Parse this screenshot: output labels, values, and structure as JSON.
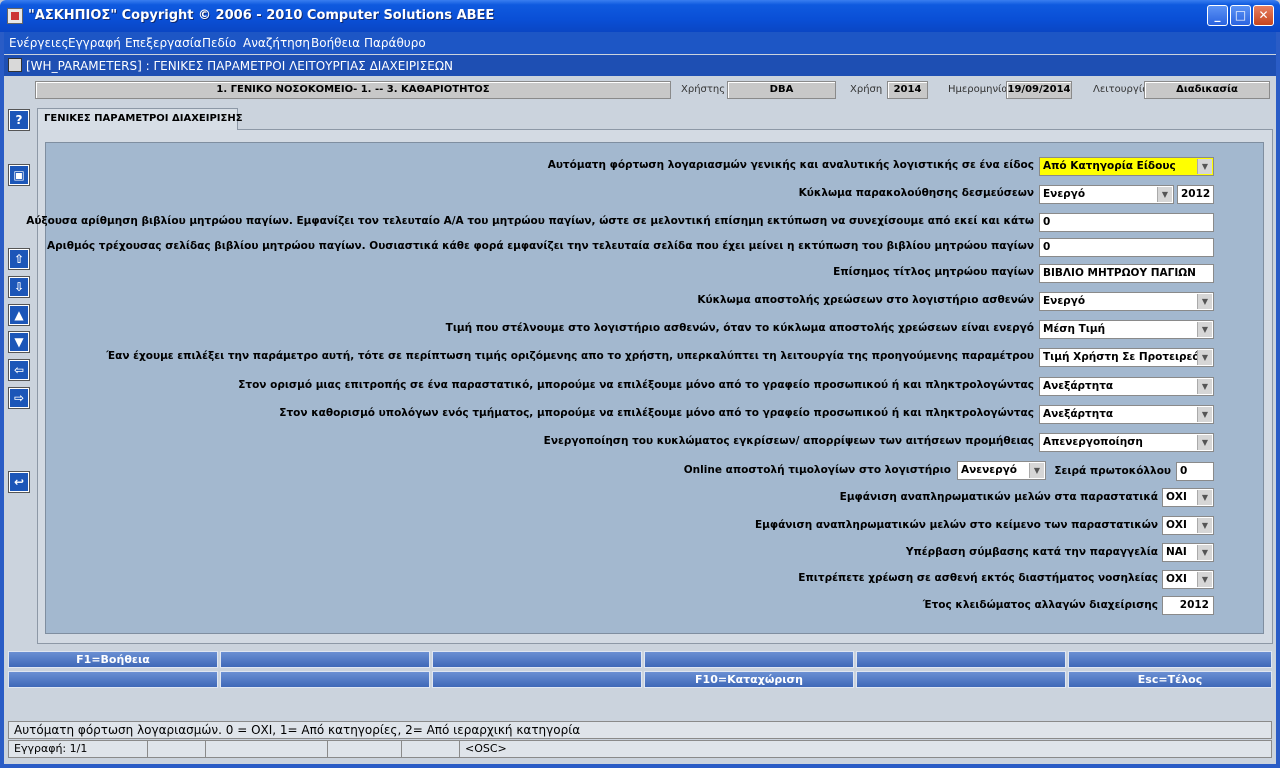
{
  "window": {
    "title": "\"ΑΣΚΗΠΙΟΣ\" Copyright © 2006 - 2010 Computer Solutions ΑΒΕΕ",
    "minimize": "_",
    "maximize": "□",
    "close": "✕"
  },
  "menu": [
    "Ενέργειες",
    "Εγγραφή",
    "Επεξεργασία",
    "Πεδίο",
    "Αναζήτηση",
    "Βοήθεια",
    "Παράθυρο"
  ],
  "form": {
    "title": "[WH_PARAMETERS]   :  ΓΕΝΙΚΕΣ ΠΑΡΑΜΕΤΡΟΙ ΛΕΙΤΟΥΡΓΙΑΣ ΔΙΑΧΕΙΡΙΣΕΩΝ"
  },
  "info": {
    "org": "1. ΓΕΝΙΚΟ ΝΟΣΟΚΟΜΕΙΟ- 1. -- 3. ΚΑΘΑΡΙΟΤΗΤΟΣ",
    "user_label": "Χρήστης",
    "user": "DBA",
    "year_label": "Χρήση",
    "year": "2014",
    "date_label": "Ημερομηνία",
    "date": "19/09/2014",
    "mode_label": "Λειτουργία",
    "mode": "Διαδικασία"
  },
  "side_icons": [
    "help-icon",
    "save-icon",
    "first-record-icon",
    "last-record-icon",
    "previous-record-icon",
    "next-record-icon",
    "previous-block-icon",
    "next-block-icon",
    "exit-icon"
  ],
  "side_glyphs": {
    "help": "?",
    "save": "▣",
    "first": "⇧",
    "last": "⇩",
    "prev": "▲",
    "next": "▼",
    "prev_block": "⇦",
    "next_block": "⇨",
    "exit": "↩"
  },
  "tab": "ΓΕΝΙΚΕΣ ΠΑΡΑΜΕΤΡΟΙ ΔΙΑΧΕΙΡΙΣΗΣ",
  "params": {
    "p1_label": "Αυτόματη φόρτωση λογαριασμών γενικής και αναλυτικής λογιστικής σε ένα είδος",
    "p1_value": "Από Κατηγορία Είδους",
    "p2_label": "Κύκλωμα παρακολούθησης δεσμεύσεων",
    "p2_value": "Ενεργό",
    "p2_year": "2012",
    "p3_label": "Αύξουσα αρίθμηση βιβλίου μητρώου παγίων. Εμφανίζει τον τελευταίο Α/Α του μητρώου παγίων, ώστε σε μελοντική επίσημη εκτύπωση να συνεχίσουμε από εκεί και κάτω",
    "p3_value": "0",
    "p4_label": "Αριθμός τρέχουσας σελίδας βιβλίου μητρώου παγίων. Ουσιαστικά κάθε φορά εμφανίζει την τελευταία σελίδα που έχει μείνει η εκτύπωση του βιβλίου μητρώου παγίων",
    "p4_value": "0",
    "p5_label": "Επίσημος τίτλος μητρώου παγίων",
    "p5_value": "ΒΙΒΛΙΟ ΜΗΤΡΩΟΥ ΠΑΓΙΩΝ",
    "p6_label": "Κύκλωμα αποστολής χρεώσεων στο λογιστήριο ασθενών",
    "p6_value": "Ενεργό",
    "p7_label": "Τιμή που στέλνουμε στο λογιστήριο ασθενών, όταν το κύκλωμα αποστολής χρεώσεων είναι ενεργό",
    "p7_value": "Μέση Τιμή",
    "p8_label": "Έαν έχουμε επιλέξει την παράμετρο αυτή, τότε σε περίπτωση τιμής οριζόμενης απο το χρήστη, υπερκαλύπτει τη λειτουργία της προηγούμενης παραμέτρου",
    "p8_value": "Τιμή Χρήστη Σε Προτειρεό...",
    "p9_label": "Στον ορισμό μιας επιτροπής σε ένα παραστατικό, μπορούμε να επιλέξουμε μόνο από το γραφείο προσωπικού ή και πληκτρολογώντας",
    "p9_value": "Ανεξάρτητα",
    "p10_label": "Στον καθορισμό υπολόγων ενός τμήματος, μπορούμε να επιλέξουμε μόνο από το γραφείο προσωπικού ή και πληκτρολογώντας",
    "p10_value": "Ανεξάρτητα",
    "p11_label": "Ενεργοποίηση του κυκλώματος εγκρίσεων/ απορρίψεων των αιτήσεων προμήθειας",
    "p11_value": "Απενεργοποίηση",
    "p12_label": "Online αποστολή τιμολογίων στο λογιστήριο",
    "p12_value": "Ανενεργό",
    "p12b_label": "Σειρά πρωτοκόλλου",
    "p12b_value": "0",
    "p13_label": "Εμφάνιση αναπληρωματικών μελών στα παραστατικά",
    "p13_value": "ΟΧΙ",
    "p14_label": "Εμφάνιση αναπληρωματικών μελών στο κείμενο των παραστατικών",
    "p14_value": "ΟΧΙ",
    "p15_label": "Υπέρβαση σύμβασης κατά την παραγγελία",
    "p15_value": "ΝΑΙ",
    "p16_label": "Επιτρέπετε χρέωση σε ασθενή εκτός διαστήματος νοσηλείας",
    "p16_value": "ΟΧΙ",
    "p17_label": "Έτος κλειδώματος αλλαγών διαχείρισης",
    "p17_value": "2012"
  },
  "fkeys": {
    "help": "F1=Βοήθεια",
    "save": "F10=Καταχώριση",
    "exit": "Esc=Τέλος"
  },
  "status": {
    "hint": "Αυτόματη φόρτωση λογαριασμών. 0 = ΟΧΙ, 1= Από κατηγορίες, 2= Από ιεραρχική κατηγορία",
    "record": "Εγγραφή: 1/1",
    "osc": "<OSC>"
  },
  "dropdown_glyph": "▼",
  "colors": {
    "titlebar": "#0a4fd6",
    "content": "#a3b8cf",
    "highlight": "#ffff00",
    "fkey": "#4a72c0"
  }
}
